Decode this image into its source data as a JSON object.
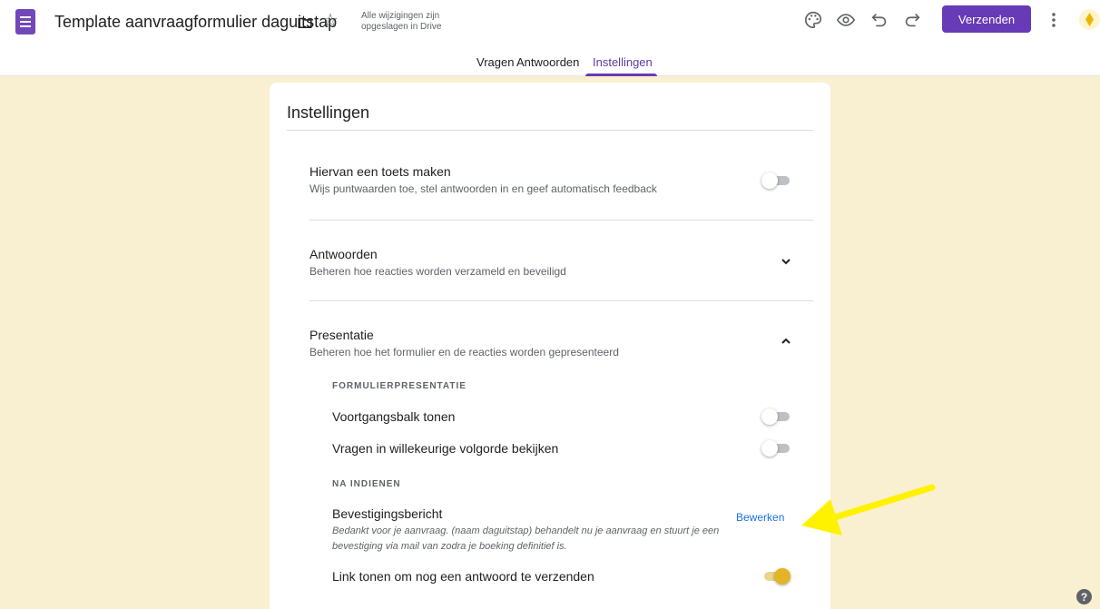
{
  "header": {
    "document_title": "Template aanvraagformulier daguitstap",
    "save_status_line1": "Alle wijzigingen zijn",
    "save_status_line2": "opgeslagen in Drive",
    "send_label": "Verzenden",
    "icons": [
      "forms-app-icon",
      "folder-icon",
      "star-icon",
      "palette-icon",
      "preview-eye-icon",
      "undo-icon",
      "redo-icon",
      "more-vert-icon",
      "account-avatar"
    ]
  },
  "tabs": [
    {
      "label": "Vragen",
      "active": false
    },
    {
      "label": "Antwoorden",
      "active": false
    },
    {
      "label": "Instellingen",
      "active": true
    }
  ],
  "settings": {
    "title": "Instellingen",
    "quiz": {
      "title": "Hiervan een toets maken",
      "description": "Wijs puntwaarden toe, stel antwoorden in en geef automatisch feedback",
      "enabled": false
    },
    "responses": {
      "title": "Antwoorden",
      "description": "Beheren hoe reacties worden verzameld en beveiligd",
      "expanded": false
    },
    "presentation": {
      "title": "Presentatie",
      "description": "Beheren hoe het formulier en de reacties worden gepresenteerd",
      "expanded": true,
      "form_presentation_heading": "FORMULIERPRESENTATIE",
      "progress_bar": {
        "label": "Voortgangsbalk tonen",
        "enabled": false
      },
      "shuffle_questions": {
        "label": "Vragen in willekeurige volgorde bekijken",
        "enabled": false
      },
      "after_submit_heading": "NA INDIENEN",
      "confirmation": {
        "label": "Bevestigingsbericht",
        "message": "Bedankt voor je aanvraag. (naam daguitstap) behandelt nu je aanvraag en stuurt je een bevestiging via mail van zodra je boeking definitief is.",
        "edit_label": "Bewerken"
      },
      "submit_another_link": {
        "label": "Link tonen om nog een antwoord te verzenden",
        "enabled": true
      }
    }
  },
  "help": {
    "label": "?"
  },
  "colors": {
    "background": "#f9f0d2",
    "brand_purple": "#673ab7",
    "toggle_on": "#e4b428",
    "link_blue": "#1a73e8",
    "annotation_arrow": "#fff200"
  }
}
